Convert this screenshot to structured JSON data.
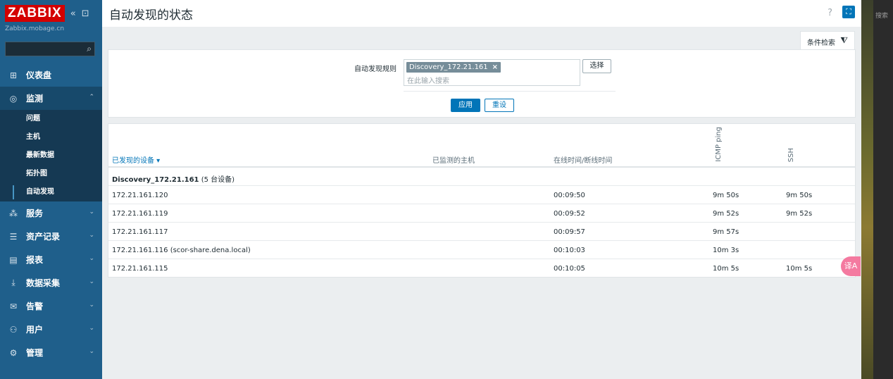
{
  "app": {
    "logo": "ZABBIX",
    "server": "Zabbix.mobage.cn"
  },
  "sidebar": {
    "collapse_icon": "«",
    "window_icon": "⊡",
    "search": {
      "value": "",
      "placeholder": ""
    },
    "items": [
      {
        "label": "仪表盘",
        "icon": "dashboard-icon",
        "glyph": "⊞"
      },
      {
        "label": "监测",
        "icon": "eye-icon",
        "glyph": "◎",
        "expanded": true,
        "children": [
          "问题",
          "主机",
          "最新数据",
          "拓扑图",
          "自动发现"
        ],
        "selected_child": "自动发现"
      },
      {
        "label": "服务",
        "icon": "services-icon",
        "glyph": "⁂"
      },
      {
        "label": "资产记录",
        "icon": "list-icon",
        "glyph": "☰"
      },
      {
        "label": "报表",
        "icon": "report-icon",
        "glyph": "▤"
      },
      {
        "label": "数据采集",
        "icon": "download-icon",
        "glyph": "⤓"
      },
      {
        "label": "告警",
        "icon": "mail-icon",
        "glyph": "✉"
      },
      {
        "label": "用户",
        "icon": "users-icon",
        "glyph": "⚇"
      },
      {
        "label": "管理",
        "icon": "gear-icon",
        "glyph": "⚙"
      }
    ]
  },
  "header": {
    "title": "自动发现的状态",
    "help": "?",
    "kiosk": "⛶"
  },
  "filter": {
    "tab_label": "条件检索",
    "rule_label": "自动发现规则",
    "selected_tag": "Discovery_172.21.161",
    "input_placeholder": "在此输入搜索",
    "select_label": "选择",
    "apply_label": "应用",
    "reset_label": "重设"
  },
  "table": {
    "columns": {
      "device": "已发现的设备 ▾",
      "monitored_host": "已监测的主机",
      "uptime": "在线时间/断线时间",
      "icmp": "ICMP ping",
      "ssh": "SSH"
    },
    "group": {
      "name": "Discovery_172.21.161",
      "count": "(5 台设备)"
    },
    "rows": [
      {
        "device": "172.21.161.120",
        "host": "",
        "uptime": "00:09:50",
        "icmp": "9m 50s",
        "ssh": "9m 50s"
      },
      {
        "device": "172.21.161.119",
        "host": "",
        "uptime": "00:09:52",
        "icmp": "9m 52s",
        "ssh": "9m 52s"
      },
      {
        "device": "172.21.161.117",
        "host": "",
        "uptime": "00:09:57",
        "icmp": "9m 57s",
        "ssh": ""
      },
      {
        "device": "172.21.161.116 (scor-share.dena.local)",
        "host": "",
        "uptime": "00:10:03",
        "icmp": "10m 3s",
        "ssh": ""
      },
      {
        "device": "172.21.161.115",
        "host": "",
        "uptime": "00:10:05",
        "icmp": "10m 5s",
        "ssh": "10m 5s"
      }
    ]
  },
  "overlay": {
    "right_panel_search": "搜索",
    "translate_bubble": "译A"
  }
}
